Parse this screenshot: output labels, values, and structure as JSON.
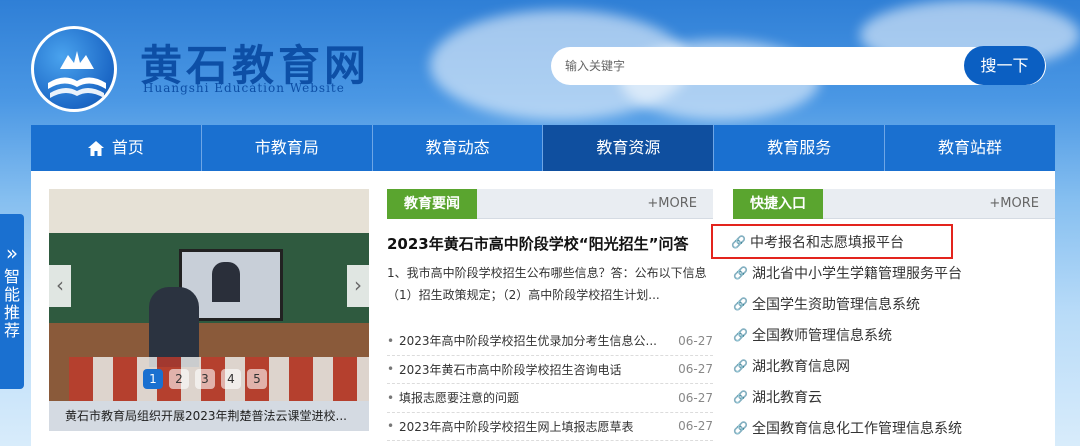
{
  "header": {
    "site_title": "黄石教育网",
    "site_subtitle": "Huangshi Education Website",
    "search_placeholder": "输入关键字",
    "search_button": "搜一下"
  },
  "nav": {
    "items": [
      {
        "label": "首页",
        "icon": "home-icon",
        "active": false
      },
      {
        "label": "市教育局",
        "active": false
      },
      {
        "label": "教育动态",
        "active": false
      },
      {
        "label": "教育资源",
        "active": true
      },
      {
        "label": "教育服务",
        "active": false
      },
      {
        "label": "教育站群",
        "active": false
      }
    ]
  },
  "side_tab": {
    "arrow": "»",
    "label": "智能推荐"
  },
  "carousel": {
    "caption": "黄石市教育局组织开展2023年荆楚普法云课堂进校...",
    "dots": [
      "1",
      "2",
      "3",
      "4",
      "5"
    ],
    "active_dot": 0
  },
  "news": {
    "tag": "教育要闻",
    "more": "+MORE",
    "headline": "2023年黄石市高中阶段学校“阳光招生”问答",
    "summary": "1、我市高中阶段学校招生公布哪些信息？答：公布以下信息（1）招生政策规定；（2）高中阶段学校招生计划...",
    "items": [
      {
        "title": "2023年高中阶段学校招生优录加分考生信息公...",
        "date": "06-27"
      },
      {
        "title": "2023年黄石市高中阶段学校招生咨询电话",
        "date": "06-27"
      },
      {
        "title": "填报志愿要注意的问题",
        "date": "06-27"
      },
      {
        "title": "2023年高中阶段学校招生网上填报志愿草表",
        "date": "06-27"
      }
    ]
  },
  "quick": {
    "tag": "快捷入口",
    "more": "+MORE",
    "items": [
      "中考报名和志愿填报平台",
      "湖北省中小学生学籍管理服务平台",
      "全国学生资助管理信息系统",
      "全国教师管理信息系统",
      "湖北教育信息网",
      "湖北教育云",
      "全国教育信息化工作管理信息系统"
    ]
  },
  "colors": {
    "nav_bg": "#1a70d0",
    "nav_active": "#0f4f9f",
    "tag_green": "#5aa52f",
    "highlight_red": "#e3241d"
  }
}
